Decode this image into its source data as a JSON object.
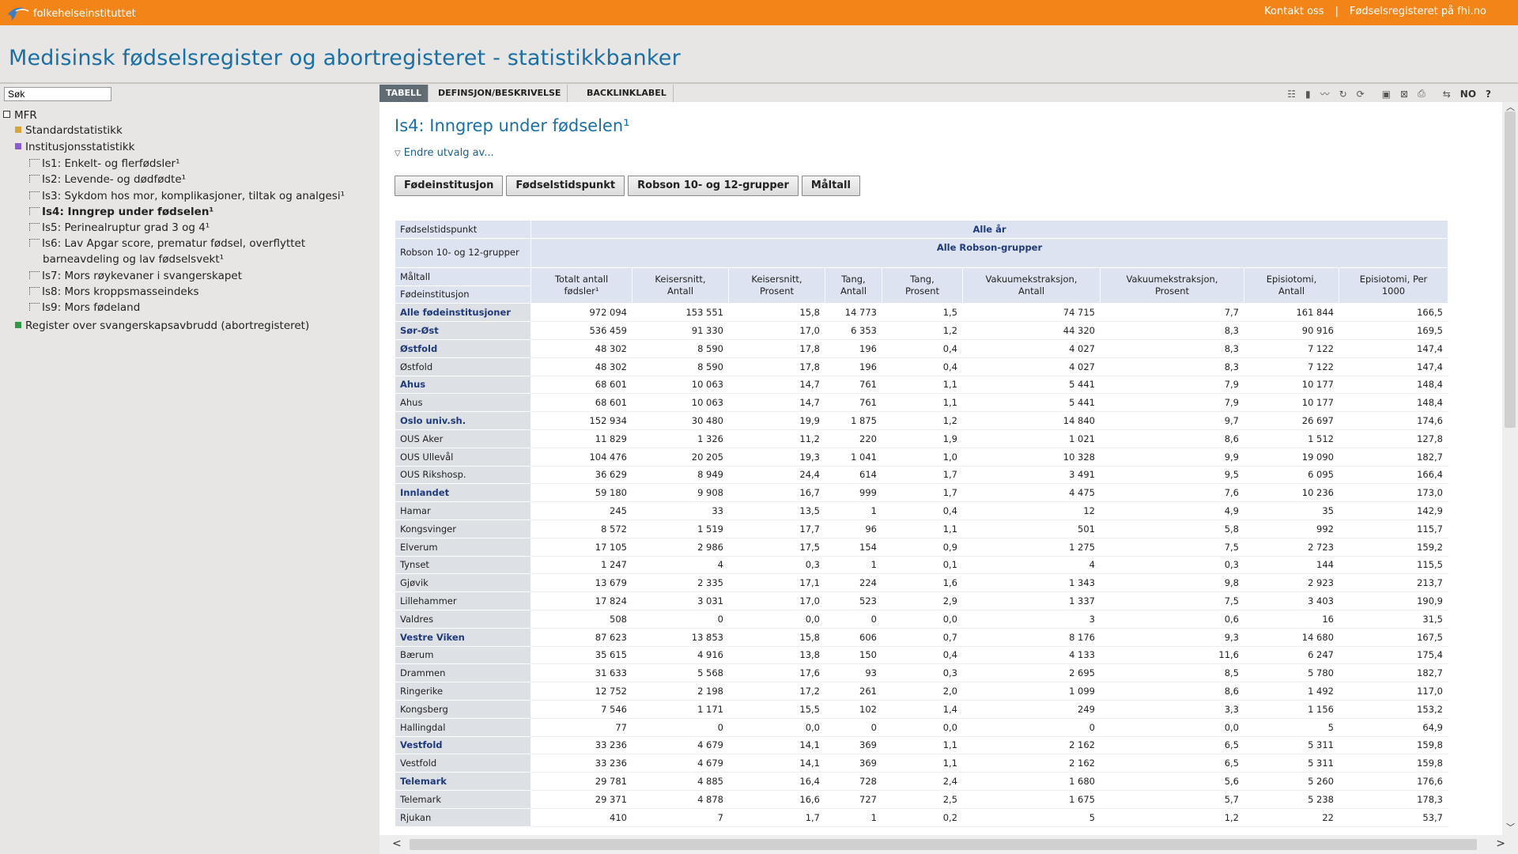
{
  "topbar": {
    "logo_text": "folkehelseinstituttet",
    "links": [
      "Kontakt oss",
      "Fødselsregisteret på fhi.no"
    ],
    "color": "#f28418"
  },
  "app_title": "Medisinsk fødselsregister og abortregisteret - statistikkbanker",
  "search": {
    "placeholder": "Søk",
    "value": "Søk"
  },
  "tree": {
    "root": "MFR",
    "standard": "Standardstatistikk",
    "institusjon": "Institusjonsstatistikk",
    "items": [
      "Is1: Enkelt- og flerfødsler¹",
      "Is2: Levende- og dødfødte¹",
      "Is3: Sykdom hos mor, komplikasjoner, tiltak og analgesi¹",
      "Is4: Inngrep under fødselen¹",
      "Is5: Perinealruptur grad 3 og 4¹",
      "Is6: Lav Apgar score, prematur fødsel, overflyttet",
      "barneavdeling og lav fødselsvekt¹",
      "Is7: Mors røykevaner i svangerskapet",
      "Is8: Mors kroppsmasseindeks",
      "Is9: Mors fødeland"
    ],
    "register": "Register over svangerskapsavbrudd (abortregisteret)"
  },
  "tabs": [
    "TABELL",
    "DEFINSJON/BESKRIVELSE",
    "BACKLINKLABEL"
  ],
  "toolbar": {
    "lang": "NO",
    "help": "?"
  },
  "content": {
    "title": "Is4: Inngrep under fødselen¹",
    "endre": "Endre utvalg av...",
    "buttons": [
      "Fødeinstitusjon",
      "Fødselstidspunkt",
      "Robson 10- og 12-grupper",
      "Måltall"
    ]
  },
  "table": {
    "h_fodselstidspunkt": "Fødselstidspunkt",
    "v_alle_ar": "Alle år",
    "h_robson": "Robson 10- og 12-grupper",
    "v_alle_robson": "Alle Robson-grupper",
    "h_maltall": "Måltall",
    "h_fodeinstitusjon": "Fødeinstitusjon",
    "columns": [
      [
        "Totalt antall",
        "fødsler¹"
      ],
      [
        "Keisersnitt,",
        "Antall"
      ],
      [
        "Keisersnitt,",
        "Prosent"
      ],
      [
        "Tang,",
        "Antall"
      ],
      [
        "Tang,",
        "Prosent"
      ],
      [
        "Vakuumekstraksjon,",
        "Antall"
      ],
      [
        "Vakuumekstraksjon,",
        "Prosent"
      ],
      [
        "Episiotomi,",
        "Antall"
      ],
      [
        "Episiotomi, Per",
        "1000"
      ]
    ],
    "rows": [
      {
        "label": "Alle fødeinstitusjoner",
        "bold": true,
        "v": [
          "972 094",
          "153 551",
          "15,8",
          "14 773",
          "1,5",
          "74 715",
          "7,7",
          "161 844",
          "166,5"
        ]
      },
      {
        "label": "Sør-Øst",
        "bold": true,
        "v": [
          "536 459",
          "91 330",
          "17,0",
          "6 353",
          "1,2",
          "44 320",
          "8,3",
          "90 916",
          "169,5"
        ]
      },
      {
        "label": "Østfold",
        "bold": true,
        "v": [
          "48 302",
          "8 590",
          "17,8",
          "196",
          "0,4",
          "4 027",
          "8,3",
          "7 122",
          "147,4"
        ]
      },
      {
        "label": "Østfold",
        "bold": false,
        "v": [
          "48 302",
          "8 590",
          "17,8",
          "196",
          "0,4",
          "4 027",
          "8,3",
          "7 122",
          "147,4"
        ]
      },
      {
        "label": "Ahus",
        "bold": true,
        "v": [
          "68 601",
          "10 063",
          "14,7",
          "761",
          "1,1",
          "5 441",
          "7,9",
          "10 177",
          "148,4"
        ]
      },
      {
        "label": "Ahus",
        "bold": false,
        "v": [
          "68 601",
          "10 063",
          "14,7",
          "761",
          "1,1",
          "5 441",
          "7,9",
          "10 177",
          "148,4"
        ]
      },
      {
        "label": "Oslo univ.sh.",
        "bold": true,
        "v": [
          "152 934",
          "30 480",
          "19,9",
          "1 875",
          "1,2",
          "14 840",
          "9,7",
          "26 697",
          "174,6"
        ]
      },
      {
        "label": "OUS Aker",
        "bold": false,
        "v": [
          "11 829",
          "1 326",
          "11,2",
          "220",
          "1,9",
          "1 021",
          "8,6",
          "1 512",
          "127,8"
        ]
      },
      {
        "label": "OUS Ullevål",
        "bold": false,
        "v": [
          "104 476",
          "20 205",
          "19,3",
          "1 041",
          "1,0",
          "10 328",
          "9,9",
          "19 090",
          "182,7"
        ]
      },
      {
        "label": "OUS Rikshosp.",
        "bold": false,
        "v": [
          "36 629",
          "8 949",
          "24,4",
          "614",
          "1,7",
          "3 491",
          "9,5",
          "6 095",
          "166,4"
        ]
      },
      {
        "label": "Innlandet",
        "bold": true,
        "v": [
          "59 180",
          "9 908",
          "16,7",
          "999",
          "1,7",
          "4 475",
          "7,6",
          "10 236",
          "173,0"
        ]
      },
      {
        "label": "Hamar",
        "bold": false,
        "v": [
          "245",
          "33",
          "13,5",
          "1",
          "0,4",
          "12",
          "4,9",
          "35",
          "142,9"
        ]
      },
      {
        "label": "Kongsvinger",
        "bold": false,
        "v": [
          "8 572",
          "1 519",
          "17,7",
          "96",
          "1,1",
          "501",
          "5,8",
          "992",
          "115,7"
        ]
      },
      {
        "label": "Elverum",
        "bold": false,
        "v": [
          "17 105",
          "2 986",
          "17,5",
          "154",
          "0,9",
          "1 275",
          "7,5",
          "2 723",
          "159,2"
        ]
      },
      {
        "label": "Tynset",
        "bold": false,
        "v": [
          "1 247",
          "4",
          "0,3",
          "1",
          "0,1",
          "4",
          "0,3",
          "144",
          "115,5"
        ]
      },
      {
        "label": "Gjøvik",
        "bold": false,
        "v": [
          "13 679",
          "2 335",
          "17,1",
          "224",
          "1,6",
          "1 343",
          "9,8",
          "2 923",
          "213,7"
        ]
      },
      {
        "label": "Lillehammer",
        "bold": false,
        "v": [
          "17 824",
          "3 031",
          "17,0",
          "523",
          "2,9",
          "1 337",
          "7,5",
          "3 403",
          "190,9"
        ]
      },
      {
        "label": "Valdres",
        "bold": false,
        "v": [
          "508",
          "0",
          "0,0",
          "0",
          "0,0",
          "3",
          "0,6",
          "16",
          "31,5"
        ]
      },
      {
        "label": "Vestre Viken",
        "bold": true,
        "v": [
          "87 623",
          "13 853",
          "15,8",
          "606",
          "0,7",
          "8 176",
          "9,3",
          "14 680",
          "167,5"
        ]
      },
      {
        "label": "Bærum",
        "bold": false,
        "v": [
          "35 615",
          "4 916",
          "13,8",
          "150",
          "0,4",
          "4 133",
          "11,6",
          "6 247",
          "175,4"
        ]
      },
      {
        "label": "Drammen",
        "bold": false,
        "v": [
          "31 633",
          "5 568",
          "17,6",
          "93",
          "0,3",
          "2 695",
          "8,5",
          "5 780",
          "182,7"
        ]
      },
      {
        "label": "Ringerike",
        "bold": false,
        "v": [
          "12 752",
          "2 198",
          "17,2",
          "261",
          "2,0",
          "1 099",
          "8,6",
          "1 492",
          "117,0"
        ]
      },
      {
        "label": "Kongsberg",
        "bold": false,
        "v": [
          "7 546",
          "1 171",
          "15,5",
          "102",
          "1,4",
          "249",
          "3,3",
          "1 156",
          "153,2"
        ]
      },
      {
        "label": "Hallingdal",
        "bold": false,
        "v": [
          "77",
          "0",
          "0,0",
          "0",
          "0,0",
          "0",
          "0,0",
          "5",
          "64,9"
        ]
      },
      {
        "label": "Vestfold",
        "bold": true,
        "v": [
          "33 236",
          "4 679",
          "14,1",
          "369",
          "1,1",
          "2 162",
          "6,5",
          "5 311",
          "159,8"
        ]
      },
      {
        "label": "Vestfold",
        "bold": false,
        "v": [
          "33 236",
          "4 679",
          "14,1",
          "369",
          "1,1",
          "2 162",
          "6,5",
          "5 311",
          "159,8"
        ]
      },
      {
        "label": "Telemark",
        "bold": true,
        "v": [
          "29 781",
          "4 885",
          "16,4",
          "728",
          "2,4",
          "1 680",
          "5,6",
          "5 260",
          "176,6"
        ]
      },
      {
        "label": "Telemark",
        "bold": false,
        "v": [
          "29 371",
          "4 878",
          "16,6",
          "727",
          "2,5",
          "1 675",
          "5,7",
          "5 238",
          "178,3"
        ]
      },
      {
        "label": "Rjukan",
        "bold": false,
        "v": [
          "410",
          "7",
          "1,7",
          "1",
          "0,2",
          "5",
          "1,2",
          "22",
          "53,7"
        ]
      }
    ]
  }
}
